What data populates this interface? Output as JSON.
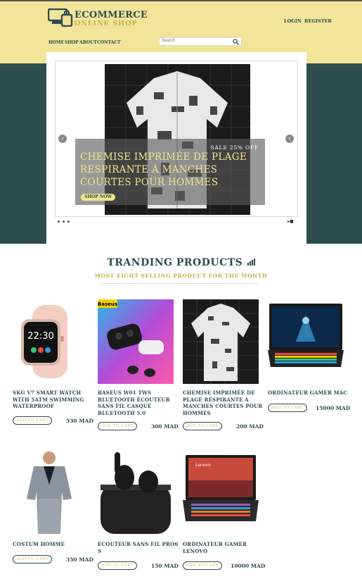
{
  "header": {
    "logo_title": "ECOMMERCE",
    "logo_subtitle": "ONLINE SHOP",
    "logo_icon": "shop-logo-icon",
    "login": "LOGIN",
    "register": "REGISTER",
    "nav": [
      "HOME",
      "SHOP",
      "ABOUT",
      "CONTACT"
    ],
    "search_placeholder": "Search",
    "search_icon": "search-icon"
  },
  "slider": {
    "sale_text": "SALE 25% OFF",
    "caption": "CHEMISE IMPRIMÉE DE PLAGE RESPIRANTE À MANCHES COURTES POUR HOMMES",
    "button": "SHOP NOW",
    "prev": "‹",
    "next": "›",
    "control": "▸■"
  },
  "trending": {
    "title": "TRANDING PRODUCTS",
    "subtitle": "MOST EIGHT SELLING PRODUCT FOR THE MONTH",
    "title_icon": "bar-chart-icon"
  },
  "products": [
    {
      "name": "SKG V7 SMART WATCH WITH 5ATM SWIMMING WATERPROOF",
      "price": "530 MAD",
      "cart": "ADD TO CART"
    },
    {
      "name": "BASEUS W01 TWS BLUETOOTH ÉCOUTEUR SANS FIL CASQUE BLUETOOTH 5.0",
      "price": "300 MAD",
      "cart": "ADD TO CART"
    },
    {
      "name": "CHEMISE IMPRIMÉE DE PLAGE RESPIRANTE À MANCHES COURTES POUR HOMMES",
      "price": "200 MAD",
      "cart": "ADD TO CART"
    },
    {
      "name": "ORDINATEUR GAMER MAC",
      "price": "15000 MAD",
      "cart": "ADD TO CART"
    },
    {
      "name": "COSTUM HOMME",
      "price": "350 MAD",
      "cart": "ADD TO CART"
    },
    {
      "name": "ECOUTEUR SANS FIL PRO6 S",
      "price": "150 MAD",
      "cart": "ADD TO CART"
    },
    {
      "name": "ORDINATEUR GAMER LENOVO",
      "price": "10000 MAD",
      "cart": "ADD TO CART"
    }
  ],
  "brand_badge": "Baseus",
  "watch_time": "22:30",
  "laptop_screen_brand": "Lenovo",
  "colors": {
    "header_bg": "#f2e59a",
    "teal": "#2e4e4d",
    "gold": "#c9ae4d",
    "text": "#2f4a4f"
  }
}
